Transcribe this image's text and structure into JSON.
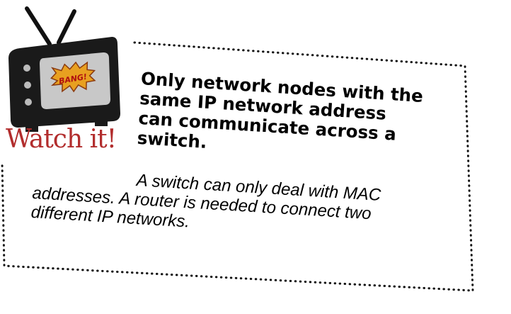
{
  "callout": {
    "label": "Watch it!",
    "badge": "BANG!",
    "title_lines": [
      "Only network nodes with the",
      "same IP network address",
      "can communicate across a",
      "switch."
    ],
    "body_lines": [
      "A switch can only deal with MAC",
      "addresses. A router is needed to connect two",
      "different IP networks."
    ]
  },
  "colors": {
    "label": "#b22d2d",
    "tv_body": "#1a1a1a",
    "tv_screen": "#c8c8c8",
    "badge": "#e8a020"
  }
}
